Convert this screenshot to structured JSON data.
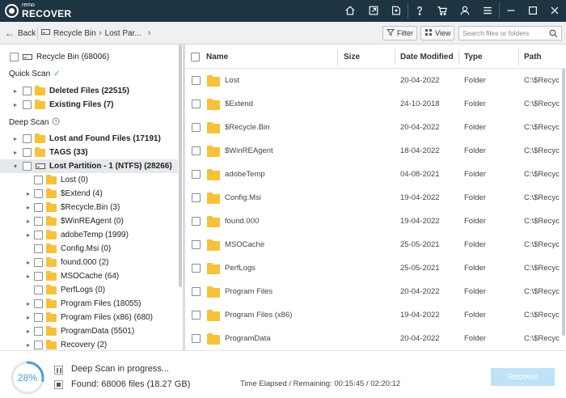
{
  "app": {
    "brand": "remo",
    "product": "RECOVER"
  },
  "titlebar_icons": [
    "home-icon",
    "export-icon",
    "save-session-icon",
    "help-icon",
    "cart-icon",
    "user-icon",
    "menu-icon",
    "minimize-icon",
    "maximize-icon",
    "close-icon"
  ],
  "toolbar": {
    "back_label": "Back",
    "crumbs": [
      "Recycle Bin",
      "Lost Par..."
    ],
    "filter_label": "Filter",
    "view_label": "View",
    "search_placeholder": "Search files or folders"
  },
  "tree": {
    "root": {
      "label": "Recycle Bin (68006)"
    },
    "quick_scan_title": "Quick Scan",
    "quick_scan_items": [
      {
        "label": "Deleted Files (22515)"
      },
      {
        "label": "Existing Files (7)"
      }
    ],
    "deep_scan_title": "Deep Scan",
    "deep_scan_items": [
      {
        "label": "Lost and Found Files (17191)"
      },
      {
        "label": "TAGS (33)"
      },
      {
        "label": "Lost Partition - 1 (NTFS) (28266)"
      }
    ],
    "partition_children": [
      {
        "label": "Lost (0)"
      },
      {
        "label": "$Extend (4)"
      },
      {
        "label": "$Recycle.Bin (3)"
      },
      {
        "label": "$WinREAgent (0)"
      },
      {
        "label": "adobeTemp (1999)"
      },
      {
        "label": "Config.Msi (0)"
      },
      {
        "label": "found.000 (2)"
      },
      {
        "label": "MSOCache (64)"
      },
      {
        "label": "PerfLogs (0)"
      },
      {
        "label": "Program Files (18055)"
      },
      {
        "label": "Program Files (x86) (680)"
      },
      {
        "label": "ProgramData (5501)"
      },
      {
        "label": "Recovery (2)"
      }
    ]
  },
  "table": {
    "columns": [
      "Name",
      "Size",
      "Date Modified",
      "Type",
      "Path"
    ],
    "rows": [
      {
        "name": "Lost",
        "size": "",
        "date": "20-04-2022",
        "type": "Folder",
        "path": "C:\\$Recyc"
      },
      {
        "name": "$Extend",
        "size": "",
        "date": "24-10-2018",
        "type": "Folder",
        "path": "C:\\$Recyc"
      },
      {
        "name": "$Recycle.Bin",
        "size": "",
        "date": "20-04-2022",
        "type": "Folder",
        "path": "C:\\$Recyc"
      },
      {
        "name": "$WinREAgent",
        "size": "",
        "date": "18-04-2022",
        "type": "Folder",
        "path": "C:\\$Recyc"
      },
      {
        "name": "adobeTemp",
        "size": "",
        "date": "04-08-2021",
        "type": "Folder",
        "path": "C:\\$Recyc"
      },
      {
        "name": "Config.Msi",
        "size": "",
        "date": "19-04-2022",
        "type": "Folder",
        "path": "C:\\$Recyc"
      },
      {
        "name": "found.000",
        "size": "",
        "date": "19-04-2022",
        "type": "Folder",
        "path": "C:\\$Recyc"
      },
      {
        "name": "MSOCache",
        "size": "",
        "date": "25-05-2021",
        "type": "Folder",
        "path": "C:\\$Recyc"
      },
      {
        "name": "PerfLogs",
        "size": "",
        "date": "25-05-2021",
        "type": "Folder",
        "path": "C:\\$Recyc"
      },
      {
        "name": "Program Files",
        "size": "",
        "date": "20-04-2022",
        "type": "Folder",
        "path": "C:\\$Recyc"
      },
      {
        "name": "Program Files (x86)",
        "size": "",
        "date": "19-04-2022",
        "type": "Folder",
        "path": "C:\\$Recyc"
      },
      {
        "name": "ProgramData",
        "size": "",
        "date": "20-04-2022",
        "type": "Folder",
        "path": "C:\\$Recyc"
      }
    ]
  },
  "status": {
    "progress_percent": 28,
    "progress_label": "28%",
    "scan_state": "Deep Scan in progress...",
    "found_label": "Found: 68006 files (18.27 GB)",
    "elapsed": "Time Elapsed / Remaining: 00:15:45 / 02:20:12",
    "recover_label": "Recover"
  },
  "colors": {
    "titlebar": "#1d3542",
    "folder": "#f5c23a",
    "progress": "#4a9fd8",
    "recover_disabled": "#bfe2f7",
    "quick_scan_check": "#3cb371"
  }
}
